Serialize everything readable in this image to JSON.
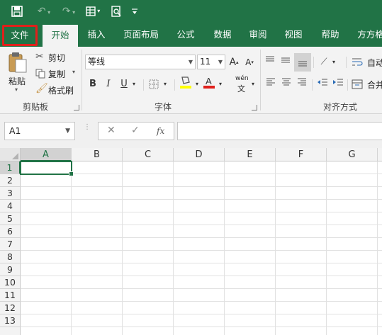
{
  "qat": {
    "save_icon": "save-icon",
    "undo_icon": "undo-icon",
    "redo_icon": "redo-icon",
    "form_icon": "form-icon",
    "preview_icon": "print-preview-icon",
    "customize_icon": "customize-qat-icon"
  },
  "tabs": [
    "文件",
    "开始",
    "插入",
    "页面布局",
    "公式",
    "数据",
    "审阅",
    "视图",
    "帮助",
    "方方格"
  ],
  "active_tab": "开始",
  "clipboard": {
    "paste": "粘贴",
    "cut": "剪切",
    "copy": "复制",
    "format_painter": "格式刷",
    "group_label": "剪贴板"
  },
  "font": {
    "font_name": "等线",
    "font_size": "11",
    "bold": "B",
    "italic": "I",
    "underline": "U",
    "phonetic_top": "wén",
    "phonetic_bottom": "文",
    "group_label": "字体",
    "highlight_color": "#ffff00",
    "font_color": "#e0201b"
  },
  "alignment": {
    "wrap_text": "自动",
    "merge": "合并",
    "group_label": "对齐方式"
  },
  "formula_bar": {
    "name_box": "A1",
    "fx": "fx"
  },
  "grid": {
    "columns": [
      "A",
      "B",
      "C",
      "D",
      "E",
      "F",
      "G"
    ],
    "rows": [
      "1",
      "2",
      "3",
      "4",
      "5",
      "6",
      "7",
      "8",
      "9",
      "10",
      "11",
      "12",
      "13"
    ],
    "selected_cell": "A1"
  },
  "colors": {
    "brand": "#217346",
    "highlight_border": "#e0201b"
  }
}
